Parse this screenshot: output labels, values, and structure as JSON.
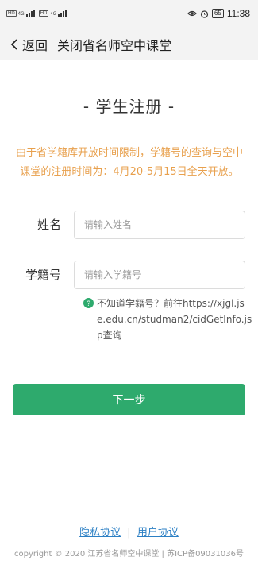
{
  "status_bar": {
    "hd1": "HD",
    "hd2": "HD",
    "sig1": "4G",
    "sig2": "4G",
    "battery": "65",
    "time": "11:38"
  },
  "nav": {
    "back_label": "返回",
    "title": "关闭省名师空中课堂"
  },
  "page": {
    "title": "- 学生注册 -",
    "notice": "由于省学籍库开放时间限制，学籍号的查询与空中课堂的注册时间为：4月20-5月15日全天开放。"
  },
  "form": {
    "name_label": "姓名",
    "name_placeholder": "请输入姓名",
    "id_label": "学籍号",
    "id_placeholder": "请输入学籍号",
    "hint": "不知道学籍号？前往https://xjgl.jse.edu.cn/studman2/cidGetInfo.jsp查询"
  },
  "actions": {
    "next_label": "下一步"
  },
  "footer": {
    "privacy_link": "隐私协议",
    "separator": "|",
    "user_link": "用户协议",
    "copyright": "copyright © 2020 江苏省名师空中课堂 | 苏ICP备09031036号"
  },
  "colors": {
    "accent": "#2eaa6d",
    "notice": "#e8a04d",
    "link": "#2b7fc4"
  }
}
